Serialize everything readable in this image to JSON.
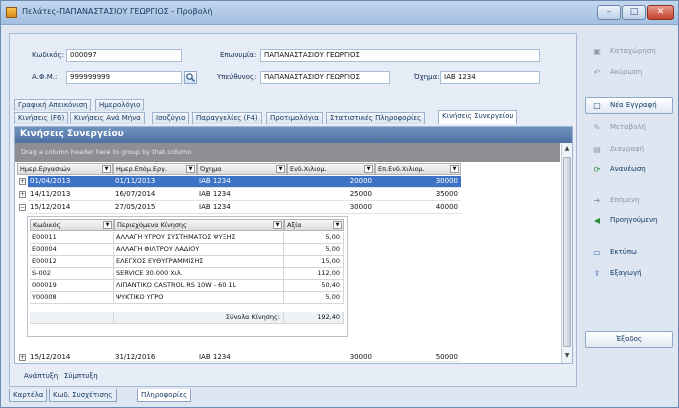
{
  "window": {
    "title": "Πελάτες-ΠΑΠΑΝΑΣΤΑΣΙΟΥ ΓΕΩΡΓΙΟΣ - Προβολή",
    "min_glyph": "–",
    "max_glyph": "□",
    "close_glyph": "✕"
  },
  "form": {
    "code_label": "Κωδικός:",
    "code_value": "000097",
    "name_label": "Επωνυμία:",
    "name_value": "ΠΑΠΑΝΑΣΤΑΣΙΟΥ ΓΕΩΡΓΙΟΣ",
    "afm_label": "Α.Φ.Μ.:",
    "afm_value": "999999999",
    "responsible_label": "Υπεύθυνος:",
    "responsible_value": "ΠΑΠΑΝΑΣΤΑΣΙΟΥ ΓΕΩΡΓΙΟΣ",
    "vehicle_label": "Όχημα:",
    "vehicle_value": "ΙΑΒ 1234"
  },
  "tabs_top": [
    "Γραφική Απεικόνιση",
    "Ημερολόγιο"
  ],
  "tabs_bottom": [
    "Κινήσεις (F6)",
    "Κινήσεις Ανά Μήνα",
    "Ισοζύγιο",
    "Παραγγελίες (F4)",
    "Προτιμολόγια",
    "Στατιστικές Πληροφορίες",
    "Κινήσεις Συνεργείου"
  ],
  "panel": {
    "title": "Κινήσεις Συνεργείου",
    "group_hint": "Drag a column header here to group by that column",
    "columns": [
      "Ημερ.Εργασιών",
      "Ημερ.Επόμ.Εργ.",
      "Όχημα",
      "Ενδ.Χιλιομ.",
      "Επ.Ενδ.Χιλιομ."
    ],
    "rows": [
      {
        "expand": "+",
        "date": "01/04/2013",
        "next": "01/11/2013",
        "vehicle": "ΙΑΒ 1234",
        "km": "20000",
        "next_km": "30000",
        "selected": true
      },
      {
        "expand": "+",
        "date": "14/11/2013",
        "next": "16/07/2014",
        "vehicle": "ΙΑΒ 1234",
        "km": "25000",
        "next_km": "35000"
      },
      {
        "expand": "−",
        "date": "15/12/2014",
        "next": "27/05/2015",
        "vehicle": "ΙΑΒ 1234",
        "km": "30000",
        "next_km": "40000"
      },
      {
        "expand": "+",
        "date": "15/12/2014",
        "next": "31/12/2016",
        "vehicle": "ΙΑΒ 1234",
        "km": "30000",
        "next_km": "50000"
      }
    ],
    "detail": {
      "columns": [
        "Κωδικός",
        "Περιεχόμενα Κίνησης",
        "Αξία"
      ],
      "rows": [
        {
          "code": "E00011",
          "desc": "ΑΛΛΑΓΗ ΥΓΡΟΥ ΣΥΣΤΗΜΑΤΟΣ ΨΥΞΗΣ",
          "value": "5,00"
        },
        {
          "code": "E00004",
          "desc": "ΑΛΛΑΓΗ ΦΙΛΤΡΟΥ ΛΑΔΙΟΥ",
          "value": "5,00"
        },
        {
          "code": "E00012",
          "desc": "ΕΛΕΓΧΟΣ ΕΥΘΥΓΡΑΜΜΙΣΗΣ",
          "value": "15,00"
        },
        {
          "code": "S-002",
          "desc": "SERVICE 30.000 Χιλ.",
          "value": "112,00"
        },
        {
          "code": "000019",
          "desc": "ΛΙΠΑΝΤΙΚΟ CASTROL RS 10W - 60 1L",
          "value": "50,40"
        },
        {
          "code": "Y00008",
          "desc": "ΨΥΚΤΙΚΟ ΥΓΡΟ",
          "value": "5,00"
        }
      ],
      "total_label": "Σύνολα Κίνησης:",
      "total_value": "192,40"
    },
    "expand_label": "Ανάπτυξη",
    "collapse_label": "Σύμπτυξη"
  },
  "bottom_tabs": [
    "Καρτέλα",
    "Κωδ. Συσχέτισης",
    "Πληροφορίες"
  ],
  "side": {
    "save": "Καταχώρηση",
    "cancel": "Ακύρωση",
    "new": "Νέα Εγγραφή",
    "modify": "Μεταβολή",
    "delete": "Διαγραφή",
    "refresh": "Ανανέωση",
    "next": "Επόμενη",
    "prev": "Προηγούμενη",
    "print": "Εκτύπω",
    "export": "Εξαγωγή",
    "exit": "Έξοδος"
  },
  "colors": {
    "accent": "#3c73c6",
    "header": "#4d72a3",
    "window": "#dde6f1"
  }
}
